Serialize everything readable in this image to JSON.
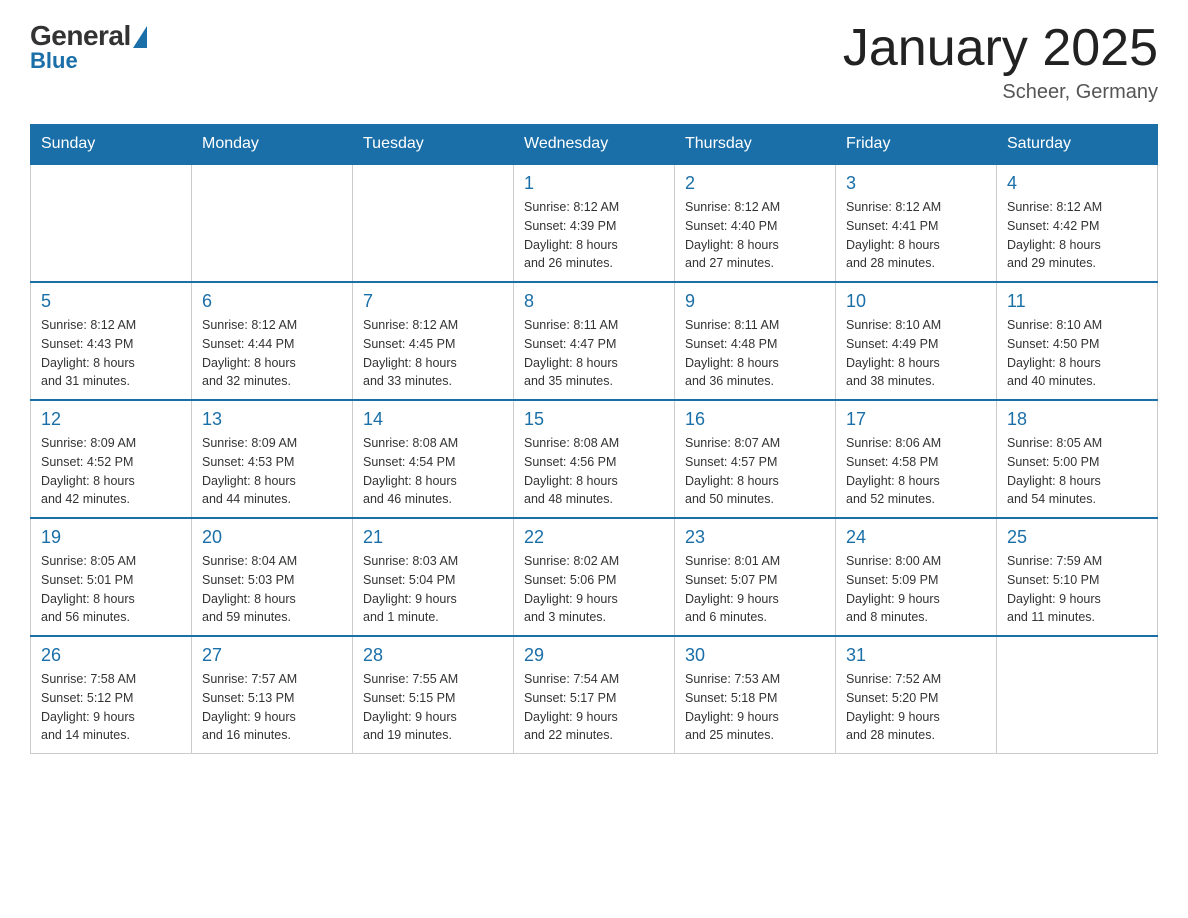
{
  "header": {
    "logo": {
      "general_text": "General",
      "blue_text": "Blue"
    },
    "title": "January 2025",
    "location": "Scheer, Germany"
  },
  "days_of_week": [
    "Sunday",
    "Monday",
    "Tuesday",
    "Wednesday",
    "Thursday",
    "Friday",
    "Saturday"
  ],
  "weeks": [
    [
      {
        "day": "",
        "info": ""
      },
      {
        "day": "",
        "info": ""
      },
      {
        "day": "",
        "info": ""
      },
      {
        "day": "1",
        "info": "Sunrise: 8:12 AM\nSunset: 4:39 PM\nDaylight: 8 hours\nand 26 minutes."
      },
      {
        "day": "2",
        "info": "Sunrise: 8:12 AM\nSunset: 4:40 PM\nDaylight: 8 hours\nand 27 minutes."
      },
      {
        "day": "3",
        "info": "Sunrise: 8:12 AM\nSunset: 4:41 PM\nDaylight: 8 hours\nand 28 minutes."
      },
      {
        "day": "4",
        "info": "Sunrise: 8:12 AM\nSunset: 4:42 PM\nDaylight: 8 hours\nand 29 minutes."
      }
    ],
    [
      {
        "day": "5",
        "info": "Sunrise: 8:12 AM\nSunset: 4:43 PM\nDaylight: 8 hours\nand 31 minutes."
      },
      {
        "day": "6",
        "info": "Sunrise: 8:12 AM\nSunset: 4:44 PM\nDaylight: 8 hours\nand 32 minutes."
      },
      {
        "day": "7",
        "info": "Sunrise: 8:12 AM\nSunset: 4:45 PM\nDaylight: 8 hours\nand 33 minutes."
      },
      {
        "day": "8",
        "info": "Sunrise: 8:11 AM\nSunset: 4:47 PM\nDaylight: 8 hours\nand 35 minutes."
      },
      {
        "day": "9",
        "info": "Sunrise: 8:11 AM\nSunset: 4:48 PM\nDaylight: 8 hours\nand 36 minutes."
      },
      {
        "day": "10",
        "info": "Sunrise: 8:10 AM\nSunset: 4:49 PM\nDaylight: 8 hours\nand 38 minutes."
      },
      {
        "day": "11",
        "info": "Sunrise: 8:10 AM\nSunset: 4:50 PM\nDaylight: 8 hours\nand 40 minutes."
      }
    ],
    [
      {
        "day": "12",
        "info": "Sunrise: 8:09 AM\nSunset: 4:52 PM\nDaylight: 8 hours\nand 42 minutes."
      },
      {
        "day": "13",
        "info": "Sunrise: 8:09 AM\nSunset: 4:53 PM\nDaylight: 8 hours\nand 44 minutes."
      },
      {
        "day": "14",
        "info": "Sunrise: 8:08 AM\nSunset: 4:54 PM\nDaylight: 8 hours\nand 46 minutes."
      },
      {
        "day": "15",
        "info": "Sunrise: 8:08 AM\nSunset: 4:56 PM\nDaylight: 8 hours\nand 48 minutes."
      },
      {
        "day": "16",
        "info": "Sunrise: 8:07 AM\nSunset: 4:57 PM\nDaylight: 8 hours\nand 50 minutes."
      },
      {
        "day": "17",
        "info": "Sunrise: 8:06 AM\nSunset: 4:58 PM\nDaylight: 8 hours\nand 52 minutes."
      },
      {
        "day": "18",
        "info": "Sunrise: 8:05 AM\nSunset: 5:00 PM\nDaylight: 8 hours\nand 54 minutes."
      }
    ],
    [
      {
        "day": "19",
        "info": "Sunrise: 8:05 AM\nSunset: 5:01 PM\nDaylight: 8 hours\nand 56 minutes."
      },
      {
        "day": "20",
        "info": "Sunrise: 8:04 AM\nSunset: 5:03 PM\nDaylight: 8 hours\nand 59 minutes."
      },
      {
        "day": "21",
        "info": "Sunrise: 8:03 AM\nSunset: 5:04 PM\nDaylight: 9 hours\nand 1 minute."
      },
      {
        "day": "22",
        "info": "Sunrise: 8:02 AM\nSunset: 5:06 PM\nDaylight: 9 hours\nand 3 minutes."
      },
      {
        "day": "23",
        "info": "Sunrise: 8:01 AM\nSunset: 5:07 PM\nDaylight: 9 hours\nand 6 minutes."
      },
      {
        "day": "24",
        "info": "Sunrise: 8:00 AM\nSunset: 5:09 PM\nDaylight: 9 hours\nand 8 minutes."
      },
      {
        "day": "25",
        "info": "Sunrise: 7:59 AM\nSunset: 5:10 PM\nDaylight: 9 hours\nand 11 minutes."
      }
    ],
    [
      {
        "day": "26",
        "info": "Sunrise: 7:58 AM\nSunset: 5:12 PM\nDaylight: 9 hours\nand 14 minutes."
      },
      {
        "day": "27",
        "info": "Sunrise: 7:57 AM\nSunset: 5:13 PM\nDaylight: 9 hours\nand 16 minutes."
      },
      {
        "day": "28",
        "info": "Sunrise: 7:55 AM\nSunset: 5:15 PM\nDaylight: 9 hours\nand 19 minutes."
      },
      {
        "day": "29",
        "info": "Sunrise: 7:54 AM\nSunset: 5:17 PM\nDaylight: 9 hours\nand 22 minutes."
      },
      {
        "day": "30",
        "info": "Sunrise: 7:53 AM\nSunset: 5:18 PM\nDaylight: 9 hours\nand 25 minutes."
      },
      {
        "day": "31",
        "info": "Sunrise: 7:52 AM\nSunset: 5:20 PM\nDaylight: 9 hours\nand 28 minutes."
      },
      {
        "day": "",
        "info": ""
      }
    ]
  ]
}
